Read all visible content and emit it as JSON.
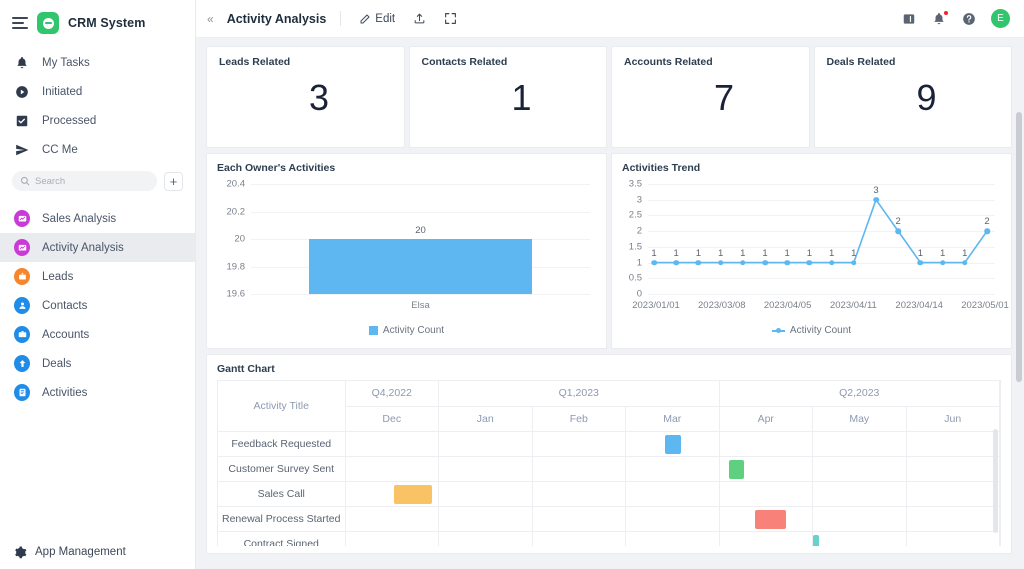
{
  "sidebar": {
    "app_title": "CRM System",
    "logo_icon": "crm-logo-icon",
    "menu_icon": "hamburger-icon",
    "top_items": [
      {
        "label": "My Tasks",
        "icon": "bell-icon"
      },
      {
        "label": "Initiated",
        "icon": "play-circle-icon"
      },
      {
        "label": "Processed",
        "icon": "inbox-check-icon"
      },
      {
        "label": "CC Me",
        "icon": "paper-plane-icon"
      }
    ],
    "search": {
      "placeholder": "Search",
      "icon": "search-icon"
    },
    "add_button_label": "+",
    "app_items": [
      {
        "label": "Sales Analysis",
        "icon": "chart-app-icon",
        "color": "#c93ad6",
        "active": false
      },
      {
        "label": "Activity Analysis",
        "icon": "chart-app-icon",
        "color": "#c93ad6",
        "active": true
      },
      {
        "label": "Leads",
        "icon": "leads-app-icon",
        "color": "#f5862e",
        "active": false
      },
      {
        "label": "Contacts",
        "icon": "contacts-app-icon",
        "color": "#1f8ce8",
        "active": false
      },
      {
        "label": "Accounts",
        "icon": "accounts-app-icon",
        "color": "#1f8ce8",
        "active": false
      },
      {
        "label": "Deals",
        "icon": "deals-app-icon",
        "color": "#1f8ce8",
        "active": false
      },
      {
        "label": "Activities",
        "icon": "activities-app-icon",
        "color": "#1f8ce8",
        "active": false
      }
    ],
    "footer": {
      "label": "App Management",
      "icon": "gear-icon"
    }
  },
  "topbar": {
    "collapse_icon": "collapse-left-icon",
    "title": "Activity Analysis",
    "edit_label": "Edit",
    "edit_icon": "pencil-icon",
    "share_icon": "share-upload-icon",
    "fullscreen_icon": "fullscreen-icon",
    "panel_icon": "side-panel-icon",
    "notification_icon": "bell-icon",
    "help_icon": "question-circle-icon",
    "avatar_initial": "E",
    "avatar_color": "#31c56d"
  },
  "kpis": [
    {
      "title": "Leads Related",
      "value": "3"
    },
    {
      "title": "Contacts Related",
      "value": "1"
    },
    {
      "title": "Accounts Related",
      "value": "7"
    },
    {
      "title": "Deals Related",
      "value": "9"
    }
  ],
  "chart_data": [
    {
      "type": "bar",
      "title": "Each Owner's Activities",
      "categories": [
        "Elsa"
      ],
      "values": [
        20
      ],
      "series": [
        {
          "name": "Activity Count",
          "values": [
            20
          ]
        }
      ],
      "legend": [
        "Activity Count"
      ],
      "legend_position": "bottom",
      "xlabel": "",
      "ylabel": "",
      "ylim": [
        19.6,
        20.4
      ],
      "yticks": [
        "19.6",
        "19.8",
        "20",
        "20.2",
        "20.4"
      ],
      "data_labels": [
        "20"
      ],
      "grid": true,
      "color": "#5eb7f0"
    },
    {
      "type": "line",
      "title": "Activities Trend",
      "x": [
        "2023/01/01",
        "2023/03/08",
        "2023/04/05",
        "2023/04/11",
        "2023/04/14",
        "2023/05/01"
      ],
      "xticks": [
        "2023/01/01",
        "2023/03/08",
        "2023/04/05",
        "2023/04/11",
        "2023/04/14",
        "2023/05/01"
      ],
      "values": [
        1,
        1,
        1,
        1,
        1,
        1,
        1,
        1,
        1,
        1,
        3,
        2,
        1,
        1,
        1,
        2
      ],
      "series": [
        {
          "name": "Activity Count",
          "values": [
            1,
            1,
            1,
            1,
            1,
            1,
            1,
            1,
            1,
            1,
            3,
            2,
            1,
            1,
            1,
            2
          ]
        }
      ],
      "legend": [
        "Activity Count"
      ],
      "legend_position": "bottom",
      "xlabel": "",
      "ylabel": "",
      "ylim": [
        0,
        3.5
      ],
      "yticks": [
        "0",
        "0.5",
        "1",
        "1.5",
        "2",
        "2.5",
        "3",
        "3.5"
      ],
      "grid": true,
      "color": "#5eb7f0"
    }
  ],
  "gantt": {
    "title": "Gantt Chart",
    "activity_column_header": "Activity Title",
    "quarters": [
      {
        "label": "Q4,2022",
        "months": 1
      },
      {
        "label": "Q1,2023",
        "months": 3
      },
      {
        "label": "Q2,2023",
        "months": 3
      }
    ],
    "months": [
      "Dec",
      "Jan",
      "Feb",
      "Mar",
      "Apr",
      "May",
      "Jun"
    ],
    "rows": [
      {
        "title": "Feedback Requested",
        "month_index": 3,
        "color": "#5eb7f0",
        "offset": 0.42,
        "width": 0.18
      },
      {
        "title": "Customer Survey Sent",
        "month_index": 4,
        "color": "#5fd07f",
        "offset": 0.1,
        "width": 0.16
      },
      {
        "title": "Sales Call",
        "month_index": 0,
        "color": "#f8c265",
        "offset": 0.52,
        "width": 0.42
      },
      {
        "title": "Renewal Process Started",
        "month_index": 4,
        "color": "#f8817a",
        "offset": 0.38,
        "width": 0.34
      },
      {
        "title": "Contract Signed",
        "month_index": 5,
        "color": "#68d0cd",
        "offset": 0.0,
        "width": 0.07
      }
    ]
  }
}
